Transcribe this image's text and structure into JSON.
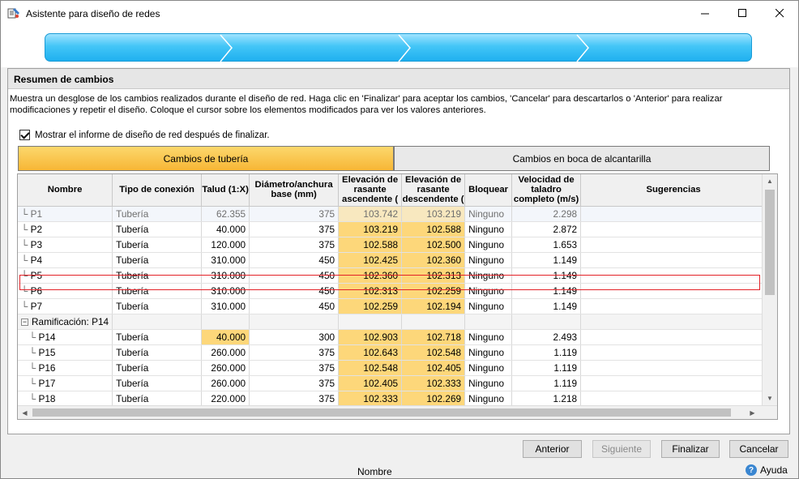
{
  "window": {
    "title": "Asistente para diseño de redes",
    "minimize_icon": "minimize-icon",
    "maximize_icon": "maximize-icon",
    "close_icon": "close-icon"
  },
  "section": {
    "title": "Resumen de cambios",
    "description": "Muestra un desglose de los cambios realizados durante el diseño de red. Haga clic en 'Finalizar' para aceptar los cambios, 'Cancelar' para descartarlos o 'Anterior' para realizar modificaciones y repetir el diseño. Coloque el cursor sobre los elementos modificados para ver los valores anteriores.",
    "checkbox_label": "Mostrar el informe de diseño de red después de finalizar.",
    "checkbox_checked": true
  },
  "tabs": [
    {
      "label": "Cambios de tubería",
      "active": true
    },
    {
      "label": "Cambios en boca de alcantarilla",
      "active": false
    }
  ],
  "table": {
    "columns": [
      "Nombre",
      "Tipo de conexión",
      "Talud (1:X)",
      "Diámetro/anchura base (mm)",
      "Elevación de rasante ascendente (",
      "Elevación de rasante descendente (",
      "Bloquear",
      "Velocidad de taladro completo (m/s)",
      "Sugerencias"
    ],
    "rows": [
      {
        "name": "P1",
        "tipo": "Tubería",
        "talud": "62.355",
        "diam": "375",
        "elev_asc": "103.742",
        "elev_desc": "103.219",
        "bloquear": "Ninguno",
        "vel": "2.298",
        "sug": "",
        "selected": true
      },
      {
        "name": "P2",
        "tipo": "Tubería",
        "talud": "40.000",
        "diam": "375",
        "elev_asc": "103.219",
        "elev_desc": "102.588",
        "bloquear": "Ninguno",
        "vel": "2.872",
        "sug": ""
      },
      {
        "name": "P3",
        "tipo": "Tubería",
        "talud": "120.000",
        "diam": "375",
        "elev_asc": "102.588",
        "elev_desc": "102.500",
        "bloquear": "Ninguno",
        "vel": "1.653",
        "sug": ""
      },
      {
        "name": "P4",
        "tipo": "Tubería",
        "talud": "310.000",
        "diam": "450",
        "elev_asc": "102.425",
        "elev_desc": "102.360",
        "bloquear": "Ninguno",
        "vel": "1.149",
        "sug": ""
      },
      {
        "name": "P5",
        "tipo": "Tubería",
        "talud": "310.000",
        "diam": "450",
        "elev_asc": "102.360",
        "elev_desc": "102.313",
        "bloquear": "Ninguno",
        "vel": "1.149",
        "sug": ""
      },
      {
        "name": "P6",
        "tipo": "Tubería",
        "talud": "310.000",
        "diam": "450",
        "elev_asc": "102.313",
        "elev_desc": "102.259",
        "bloquear": "Ninguno",
        "vel": "1.149",
        "sug": ""
      },
      {
        "name": "P7",
        "tipo": "Tubería",
        "talud": "310.000",
        "diam": "450",
        "elev_asc": "102.259",
        "elev_desc": "102.194",
        "bloquear": "Ninguno",
        "vel": "1.149",
        "sug": ""
      }
    ],
    "group_label": "Ramificación: P14",
    "group_rows": [
      {
        "name": "P14",
        "tipo": "Tubería",
        "talud": "40.000",
        "talud_hl": true,
        "diam": "300",
        "elev_asc": "102.903",
        "elev_desc": "102.718",
        "bloquear": "Ninguno",
        "vel": "2.493",
        "sug": ""
      },
      {
        "name": "P15",
        "tipo": "Tubería",
        "talud": "260.000",
        "diam": "375",
        "elev_asc": "102.643",
        "elev_desc": "102.548",
        "bloquear": "Ninguno",
        "vel": "1.119",
        "sug": ""
      },
      {
        "name": "P16",
        "tipo": "Tubería",
        "talud": "260.000",
        "diam": "375",
        "elev_asc": "102.548",
        "elev_desc": "102.405",
        "bloquear": "Ninguno",
        "vel": "1.119",
        "sug": ""
      },
      {
        "name": "P17",
        "tipo": "Tubería",
        "talud": "260.000",
        "diam": "375",
        "elev_asc": "102.405",
        "elev_desc": "102.333",
        "bloquear": "Ninguno",
        "vel": "1.119",
        "sug": ""
      },
      {
        "name": "P18",
        "tipo": "Tubería",
        "talud": "220.000",
        "diam": "375",
        "elev_asc": "102.333",
        "elev_desc": "102.269",
        "bloquear": "Ninguno",
        "vel": "1.218",
        "sug": ""
      }
    ]
  },
  "buttons": {
    "anterior": "Anterior",
    "siguiente": "Siguiente",
    "finalizar": "Finalizar",
    "cancelar": "Cancelar"
  },
  "statusbar": {
    "name": "Nombre",
    "help": "Ayuda"
  },
  "colors": {
    "progress": "#2bb8f2",
    "highlight": "#fdd77a",
    "selection_border": "#e32228"
  }
}
